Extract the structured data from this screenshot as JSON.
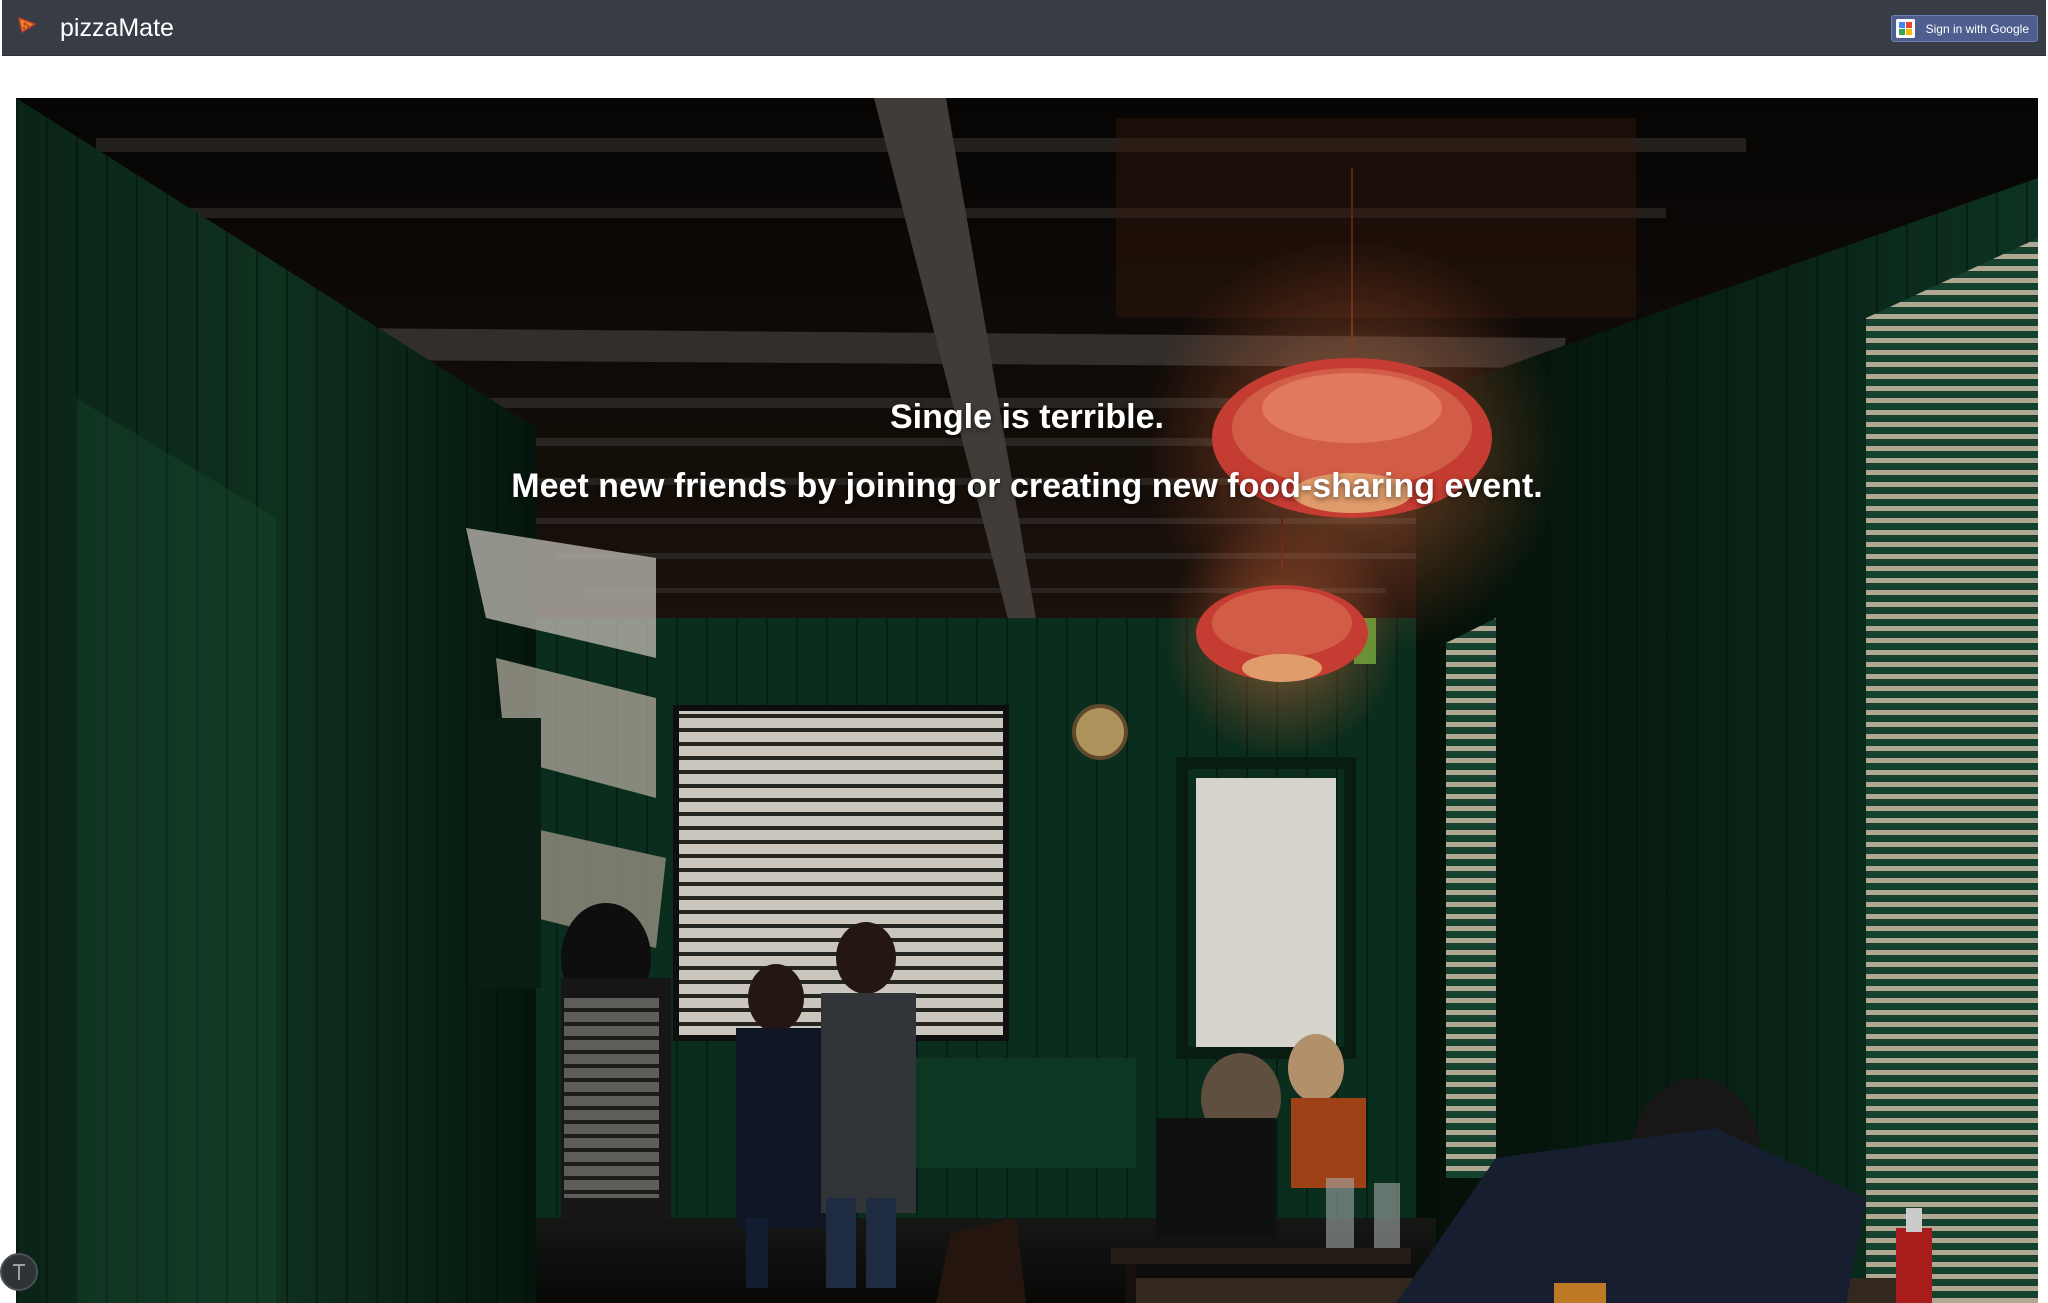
{
  "navbar": {
    "brand": "pizzaMate",
    "logo_icon": "pizza-slice-icon",
    "signin_label": "Sign in with Google",
    "signin_icon": "google-icon",
    "background_color": "#373c45"
  },
  "hero": {
    "line1": "Single is terrible.",
    "line2": "Meet new friends by joining or creating new food-sharing event.",
    "background_image": "restaurant-interior-photo"
  },
  "floating": {
    "scroll_button_icon": "arrow-up-icon"
  }
}
